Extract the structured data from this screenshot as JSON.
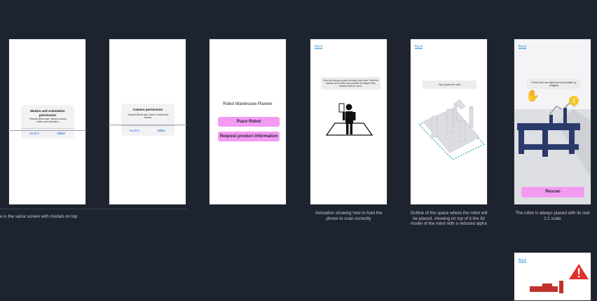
{
  "screens": {
    "s1": {
      "modal_title": "Motion and orientation permission",
      "modal_body": "\"Testudio Bifrost app\" wants to access motion and orientation",
      "decline": "Decline",
      "allow": "Allow"
    },
    "s2": {
      "modal_title": "Camera permission",
      "modal_body": "\"Testudio Bifrost app\" wants to access the camera",
      "decline": "Decline",
      "allow": "Allow"
    },
    "s3": {
      "title": "Robot Warehouse Planner",
      "place_robot": "Place Robot",
      "request_info": "Request product information"
    },
    "s4": {
      "back": "Back",
      "instruction": "Scan the area as a plan to locate your robot. Point the camera on the floor and position the target in the desired area for robot."
    },
    "s5": {
      "back": "Back",
      "instruction": "Tap to place the robot"
    },
    "s6": {
      "back": "Back",
      "instruction": "Perfect! you can adjust the robot position by dragging",
      "rescan": "Rescan"
    },
    "s7": {
      "back": "Back"
    }
  },
  "captions": {
    "c1": "e is the same screen with modals on top",
    "c4": "Animation showing how to hold the phone to scan correctly",
    "c5": "Outline of the space where the robot will be placed, showing on top of it the 3d model of the robot with a reduced alpha",
    "c6": "The robot is always placed with its real 1:1 scale"
  },
  "colors": {
    "background": "#1e2330",
    "accent_pink": "#f29bf1",
    "link_blue": "#2d9ad6",
    "info_yellow": "#f4c62a",
    "warning_red": "#e0312b"
  },
  "icons": [
    "hand-drag-icon",
    "info-icon",
    "warning-icon",
    "person-phone-icon"
  ]
}
